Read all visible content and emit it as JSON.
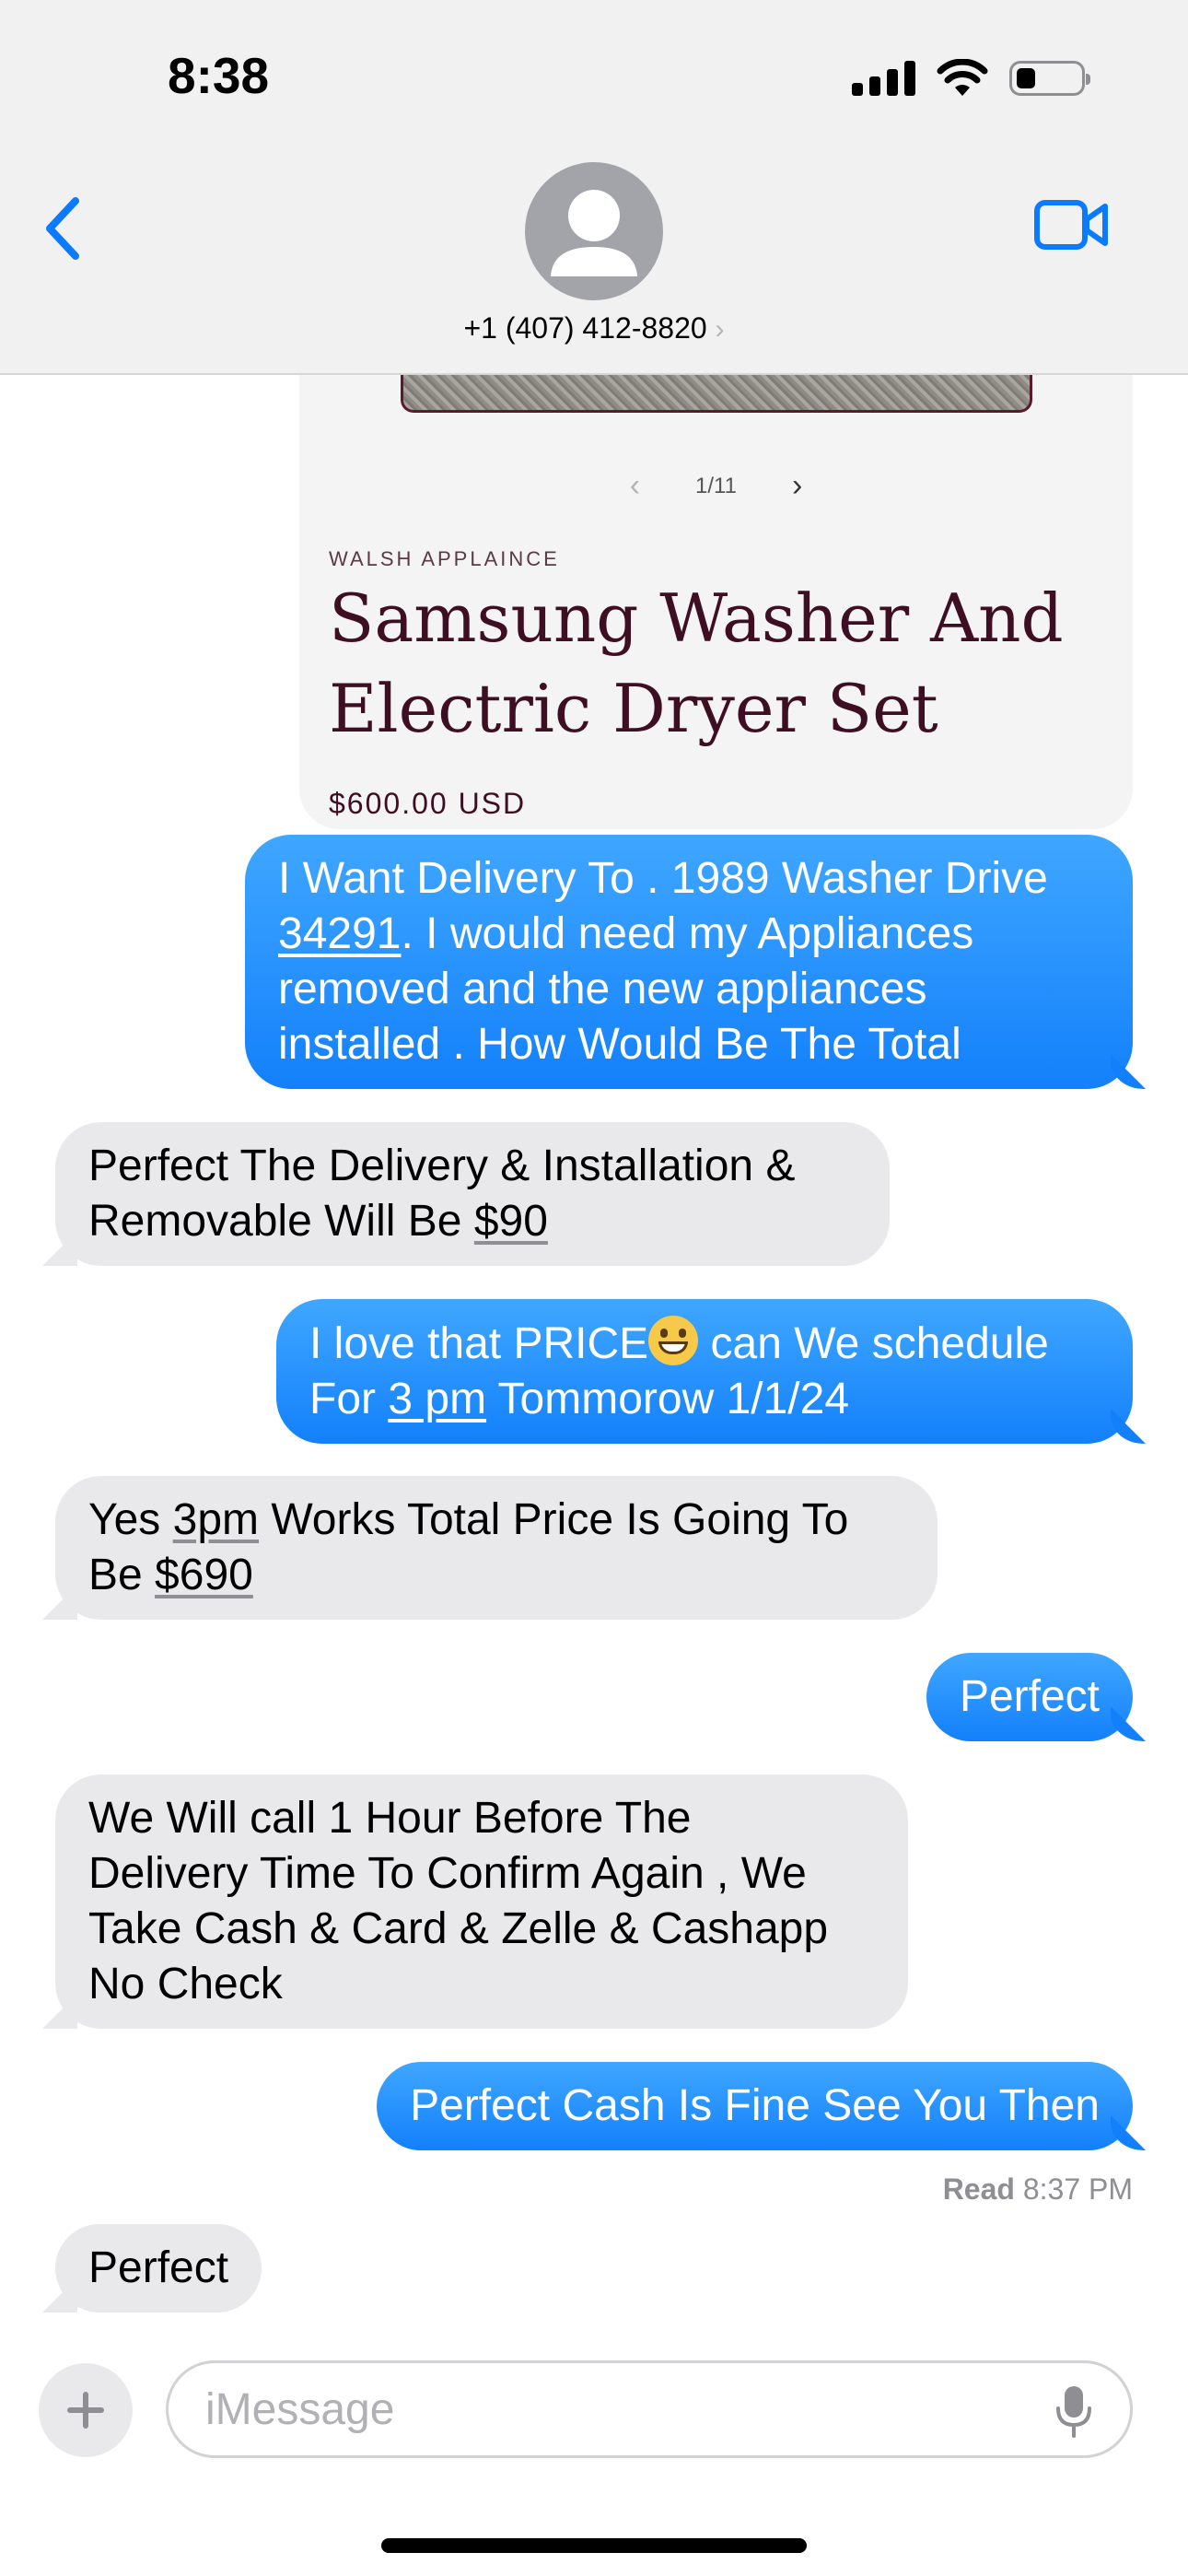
{
  "status_bar": {
    "time": "8:38"
  },
  "header": {
    "contact": "+1 (407) 412-8820",
    "contact_chevron": "›"
  },
  "link_card": {
    "pager_prev": "‹",
    "pager": "1/11",
    "pager_next": "›",
    "brand": "WALSH APPLAINCE",
    "title_line1": "Samsung Washer And",
    "title_line2": "Electric Dryer Set",
    "price": "$600.00 USD"
  },
  "messages": {
    "m1": {
      "line1": "I Want Delivery To . 1989 Washer Drive",
      "zip": "34291",
      "line2_rest": ". I would need my  Appliances",
      "line3": "removed and the new appliances",
      "line4": "installed . How Would Be The Total"
    },
    "m2": {
      "line1": "Perfect The Delivery & Installation &",
      "line2_pre": "Removable Will Be ",
      "amount": "$90"
    },
    "m3": {
      "line1_pre": "I love that PRICE",
      "line1_post": " can We schedule",
      "line2_pre": "For ",
      "time": "3 pm",
      "line2_post": " Tommorow 1/1/24"
    },
    "m4": {
      "line1_pre": "Yes ",
      "time": "3pm",
      "line1_post": " Works Total Price Is Going To",
      "line2_pre": "Be ",
      "amount": "$690"
    },
    "m5": {
      "text": "Perfect"
    },
    "m6": {
      "line1": "We Will call 1 Hour Before  The",
      "line2": "Delivery Time To Confirm Again , We",
      "line3": "Take Cash & Card & Zelle & Cashapp",
      "line4": "No Check"
    },
    "m7": {
      "text": "Perfect Cash Is Fine See You Then"
    },
    "m8": {
      "text": "Perfect"
    }
  },
  "read_receipt": {
    "label": "Read",
    "time": "8:37 PM"
  },
  "composer": {
    "placeholder": "iMessage"
  },
  "colors": {
    "outgoing": "#1380fb",
    "incoming": "#e9e9eb",
    "accent": "#0a7aff"
  },
  "icons": [
    "back-chevron-icon",
    "contact-avatar-icon",
    "video-camera-icon",
    "plus-icon",
    "microphone-icon",
    "grinning-emoji-icon"
  ]
}
